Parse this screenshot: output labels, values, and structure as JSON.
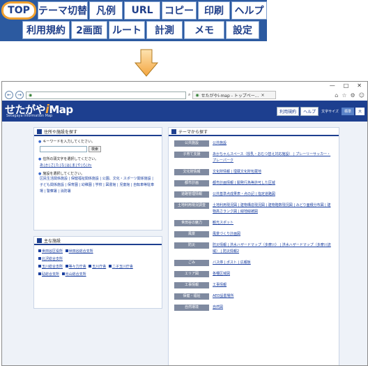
{
  "toolbar": {
    "row1": [
      "TOP",
      "テーマ切替",
      "凡例",
      "URL",
      "コピー",
      "印刷",
      "ヘルプ"
    ],
    "row2": [
      "利用規約",
      "2画面",
      "ルート",
      "計測",
      "メモ",
      "設定"
    ]
  },
  "browser": {
    "url_tab": "せたがやi-map - トップペー...",
    "window_controls": [
      "—",
      "□",
      "✕"
    ]
  },
  "site": {
    "logo": "せたがや",
    "logo_i": "i",
    "logo_map": "Map",
    "logo_sub": "Setagaya Information Map",
    "btn_terms": "利用規約",
    "btn_help": "ヘルプ",
    "font_size_label": "文字サイズ",
    "size_standard": "標準",
    "size_large": "大"
  },
  "search_panel": {
    "title": "住所や施設を探す",
    "keyword_prompt": "キーワードを入力してください。",
    "search_btn": "検索",
    "kana_prompt": "住所の頭文字を選択してください。",
    "kana_row": "あ|か|さ|た|な|は|ま|や|ら|わ",
    "facility_prompt": "施設を選択してください。",
    "facility_links": "区民生活関係施設 | 保健福祉関係施設 | 公園、文化・スポーツ関係施設 | 子ども関係施設 | 保育園 | 幼稚園 | 学校 | 図書館 | 児童館 | 自転車等駐車場 | 警察署 | 消防署"
  },
  "major_panel": {
    "title": "主な施設",
    "items": [
      "世田谷区役所",
      "世田谷総合支所",
      "北沢総合支所",
      "玉川総合支所",
      "等々力庁舎",
      "玉川庁舎",
      "二子玉川庁舎",
      "砧総合支所",
      "烏山総合支所"
    ]
  },
  "theme_panel": {
    "title": "テーマから探す",
    "rows": [
      {
        "label": "公共施設",
        "links": "公共施設"
      },
      {
        "label": "子育て支援",
        "links": "あかちゃんスペース（授乳・おむつ替え対応施設） | プレーリーサッカー・プレーパーク"
      },
      {
        "label": "文化財情報",
        "links": "文化財情報 | 埋蔵文化財包蔵地"
      },
      {
        "label": "都市計画",
        "links": "都市計画情報 | 開発行為等許可した区域"
      },
      {
        "label": "道路管理情報",
        "links": "公共基準点成果表・点の記 | 指定道路図"
      },
      {
        "label": "土地利用現況調査",
        "links": "土地利用現況図 | 建物構造現況図 | 建物階数現況図 | みどり面積分布図 | 建物高さランク図 | 緑地緑被図"
      },
      {
        "label": "世田谷の魅力",
        "links": "観光スポット"
      },
      {
        "label": "風景",
        "links": "風景づくり計画図"
      },
      {
        "label": "防災",
        "links": "防災情報 | 洪水ハザードマップ（多摩川） | 洪水ハザードマップ（多摩川流域） | 防災情報2"
      },
      {
        "label": "ごみ",
        "links": "バス停 | ポスト | 広報板"
      },
      {
        "label": "エリア図",
        "links": "各種区域図"
      },
      {
        "label": "工事情報",
        "links": "工事情報"
      },
      {
        "label": "保健・福祉",
        "links": "AED設置場所"
      },
      {
        "label": "自然環境",
        "links": "自然図"
      }
    ]
  }
}
